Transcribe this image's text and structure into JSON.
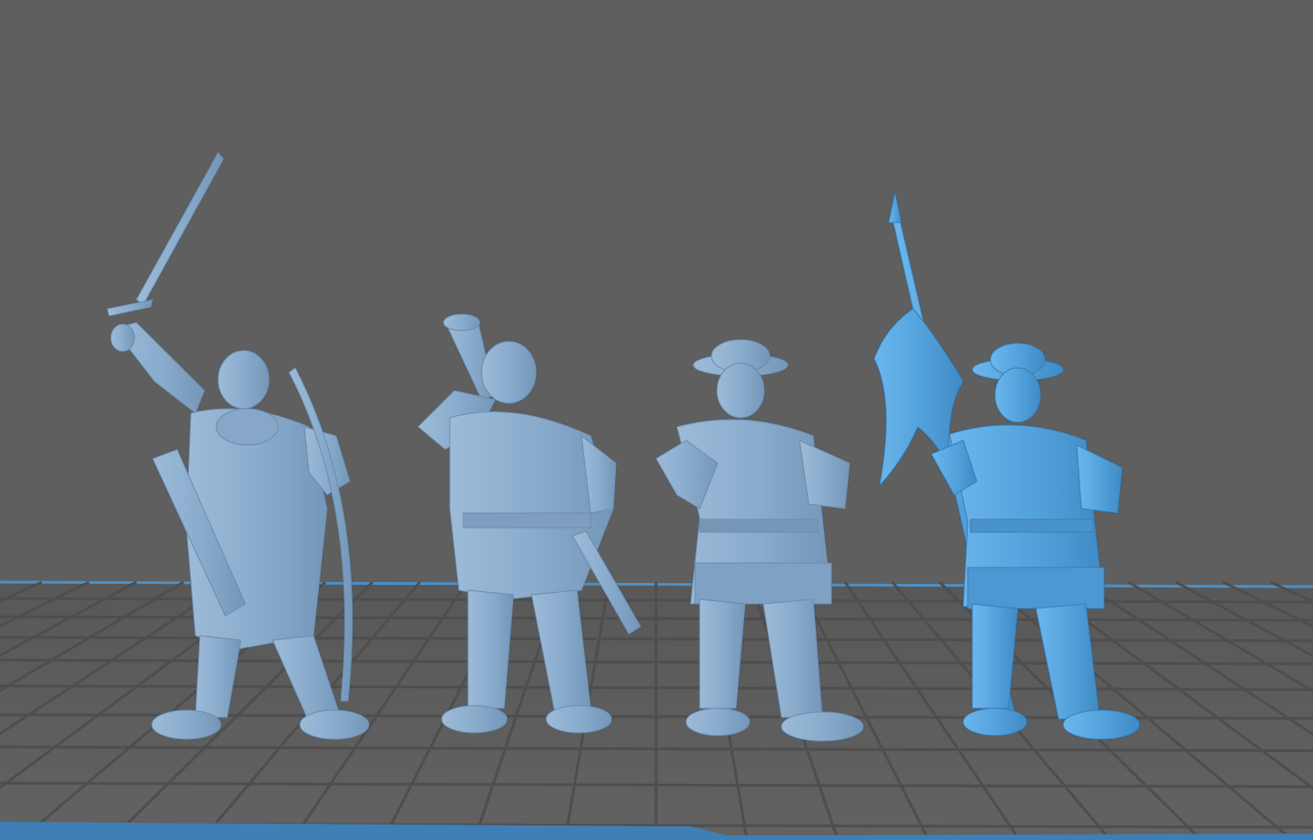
{
  "viewport": {
    "background_color": "#5f5f5f",
    "grid_color": "#4e4e4e",
    "grid_highlight_color": "#6a6a6a",
    "build_plate_edge_color": "#4a90c8"
  },
  "models": [
    {
      "id": "archer-with-sword-and-bow",
      "color": "#8fb0d0",
      "selected": false
    },
    {
      "id": "horn-blower",
      "color": "#8fb0d0",
      "selected": false
    },
    {
      "id": "soldier-with-kettle-helm",
      "color": "#8fb0d0",
      "selected": false
    },
    {
      "id": "standard-bearer",
      "color": "#5aa5de",
      "selected": true
    }
  ]
}
